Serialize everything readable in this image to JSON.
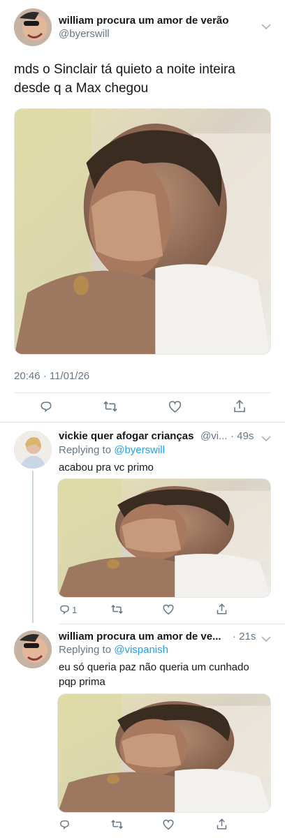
{
  "main_tweet": {
    "display_name": "william procura um amor de verão",
    "handle": "@byerswill",
    "text": "mds o Sinclair tá quieto a noite inteira desde q a Max chegou",
    "timestamp": "20:46 · 11/01/26",
    "actions": [
      "reply-icon",
      "retweet-icon",
      "like-icon",
      "share-icon"
    ]
  },
  "replies": [
    {
      "display_name": "vickie quer afogar crianças",
      "handle": "@vi...",
      "age": "· 49s",
      "replying_prefix": "Replying to ",
      "replying_to": "@byerswill",
      "text": "acabou pra vc primo",
      "reply_count": "1"
    },
    {
      "display_name": "william procura um amor de ve...",
      "handle": "",
      "age": "· 21s",
      "replying_prefix": "Replying to ",
      "replying_to": "@vispanish",
      "text": "eu só queria paz não queria um cunhado pqp prima",
      "reply_count": ""
    }
  ],
  "colors": {
    "link": "#1da1f2",
    "secondary_text": "#657786",
    "border": "#e1e8ed"
  }
}
